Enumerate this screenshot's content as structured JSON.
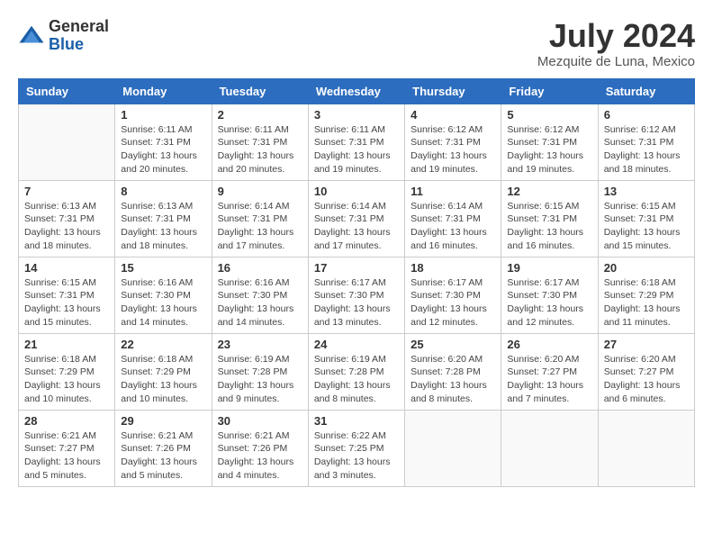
{
  "header": {
    "logo_general": "General",
    "logo_blue": "Blue",
    "month_year": "July 2024",
    "location": "Mezquite de Luna, Mexico"
  },
  "columns": [
    "Sunday",
    "Monday",
    "Tuesday",
    "Wednesday",
    "Thursday",
    "Friday",
    "Saturday"
  ],
  "weeks": [
    [
      {
        "day": "",
        "sunrise": "",
        "sunset": "",
        "daylight": ""
      },
      {
        "day": "1",
        "sunrise": "Sunrise: 6:11 AM",
        "sunset": "Sunset: 7:31 PM",
        "daylight": "Daylight: 13 hours and 20 minutes."
      },
      {
        "day": "2",
        "sunrise": "Sunrise: 6:11 AM",
        "sunset": "Sunset: 7:31 PM",
        "daylight": "Daylight: 13 hours and 20 minutes."
      },
      {
        "day": "3",
        "sunrise": "Sunrise: 6:11 AM",
        "sunset": "Sunset: 7:31 PM",
        "daylight": "Daylight: 13 hours and 19 minutes."
      },
      {
        "day": "4",
        "sunrise": "Sunrise: 6:12 AM",
        "sunset": "Sunset: 7:31 PM",
        "daylight": "Daylight: 13 hours and 19 minutes."
      },
      {
        "day": "5",
        "sunrise": "Sunrise: 6:12 AM",
        "sunset": "Sunset: 7:31 PM",
        "daylight": "Daylight: 13 hours and 19 minutes."
      },
      {
        "day": "6",
        "sunrise": "Sunrise: 6:12 AM",
        "sunset": "Sunset: 7:31 PM",
        "daylight": "Daylight: 13 hours and 18 minutes."
      }
    ],
    [
      {
        "day": "7",
        "sunrise": "Sunrise: 6:13 AM",
        "sunset": "Sunset: 7:31 PM",
        "daylight": "Daylight: 13 hours and 18 minutes."
      },
      {
        "day": "8",
        "sunrise": "Sunrise: 6:13 AM",
        "sunset": "Sunset: 7:31 PM",
        "daylight": "Daylight: 13 hours and 18 minutes."
      },
      {
        "day": "9",
        "sunrise": "Sunrise: 6:14 AM",
        "sunset": "Sunset: 7:31 PM",
        "daylight": "Daylight: 13 hours and 17 minutes."
      },
      {
        "day": "10",
        "sunrise": "Sunrise: 6:14 AM",
        "sunset": "Sunset: 7:31 PM",
        "daylight": "Daylight: 13 hours and 17 minutes."
      },
      {
        "day": "11",
        "sunrise": "Sunrise: 6:14 AM",
        "sunset": "Sunset: 7:31 PM",
        "daylight": "Daylight: 13 hours and 16 minutes."
      },
      {
        "day": "12",
        "sunrise": "Sunrise: 6:15 AM",
        "sunset": "Sunset: 7:31 PM",
        "daylight": "Daylight: 13 hours and 16 minutes."
      },
      {
        "day": "13",
        "sunrise": "Sunrise: 6:15 AM",
        "sunset": "Sunset: 7:31 PM",
        "daylight": "Daylight: 13 hours and 15 minutes."
      }
    ],
    [
      {
        "day": "14",
        "sunrise": "Sunrise: 6:15 AM",
        "sunset": "Sunset: 7:31 PM",
        "daylight": "Daylight: 13 hours and 15 minutes."
      },
      {
        "day": "15",
        "sunrise": "Sunrise: 6:16 AM",
        "sunset": "Sunset: 7:30 PM",
        "daylight": "Daylight: 13 hours and 14 minutes."
      },
      {
        "day": "16",
        "sunrise": "Sunrise: 6:16 AM",
        "sunset": "Sunset: 7:30 PM",
        "daylight": "Daylight: 13 hours and 14 minutes."
      },
      {
        "day": "17",
        "sunrise": "Sunrise: 6:17 AM",
        "sunset": "Sunset: 7:30 PM",
        "daylight": "Daylight: 13 hours and 13 minutes."
      },
      {
        "day": "18",
        "sunrise": "Sunrise: 6:17 AM",
        "sunset": "Sunset: 7:30 PM",
        "daylight": "Daylight: 13 hours and 12 minutes."
      },
      {
        "day": "19",
        "sunrise": "Sunrise: 6:17 AM",
        "sunset": "Sunset: 7:30 PM",
        "daylight": "Daylight: 13 hours and 12 minutes."
      },
      {
        "day": "20",
        "sunrise": "Sunrise: 6:18 AM",
        "sunset": "Sunset: 7:29 PM",
        "daylight": "Daylight: 13 hours and 11 minutes."
      }
    ],
    [
      {
        "day": "21",
        "sunrise": "Sunrise: 6:18 AM",
        "sunset": "Sunset: 7:29 PM",
        "daylight": "Daylight: 13 hours and 10 minutes."
      },
      {
        "day": "22",
        "sunrise": "Sunrise: 6:18 AM",
        "sunset": "Sunset: 7:29 PM",
        "daylight": "Daylight: 13 hours and 10 minutes."
      },
      {
        "day": "23",
        "sunrise": "Sunrise: 6:19 AM",
        "sunset": "Sunset: 7:28 PM",
        "daylight": "Daylight: 13 hours and 9 minutes."
      },
      {
        "day": "24",
        "sunrise": "Sunrise: 6:19 AM",
        "sunset": "Sunset: 7:28 PM",
        "daylight": "Daylight: 13 hours and 8 minutes."
      },
      {
        "day": "25",
        "sunrise": "Sunrise: 6:20 AM",
        "sunset": "Sunset: 7:28 PM",
        "daylight": "Daylight: 13 hours and 8 minutes."
      },
      {
        "day": "26",
        "sunrise": "Sunrise: 6:20 AM",
        "sunset": "Sunset: 7:27 PM",
        "daylight": "Daylight: 13 hours and 7 minutes."
      },
      {
        "day": "27",
        "sunrise": "Sunrise: 6:20 AM",
        "sunset": "Sunset: 7:27 PM",
        "daylight": "Daylight: 13 hours and 6 minutes."
      }
    ],
    [
      {
        "day": "28",
        "sunrise": "Sunrise: 6:21 AM",
        "sunset": "Sunset: 7:27 PM",
        "daylight": "Daylight: 13 hours and 5 minutes."
      },
      {
        "day": "29",
        "sunrise": "Sunrise: 6:21 AM",
        "sunset": "Sunset: 7:26 PM",
        "daylight": "Daylight: 13 hours and 5 minutes."
      },
      {
        "day": "30",
        "sunrise": "Sunrise: 6:21 AM",
        "sunset": "Sunset: 7:26 PM",
        "daylight": "Daylight: 13 hours and 4 minutes."
      },
      {
        "day": "31",
        "sunrise": "Sunrise: 6:22 AM",
        "sunset": "Sunset: 7:25 PM",
        "daylight": "Daylight: 13 hours and 3 minutes."
      },
      {
        "day": "",
        "sunrise": "",
        "sunset": "",
        "daylight": ""
      },
      {
        "day": "",
        "sunrise": "",
        "sunset": "",
        "daylight": ""
      },
      {
        "day": "",
        "sunrise": "",
        "sunset": "",
        "daylight": ""
      }
    ]
  ]
}
